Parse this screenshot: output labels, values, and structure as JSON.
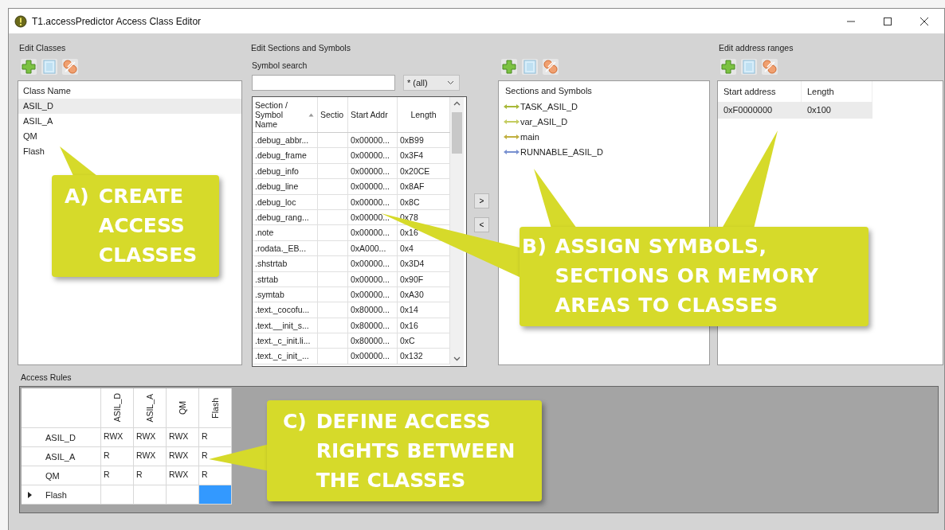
{
  "window": {
    "title": "T1.accessPredictor Access Class Editor"
  },
  "edit_classes": {
    "label": "Edit Classes",
    "column": "Class Name",
    "classes": [
      {
        "name": "ASIL_D",
        "selected": true
      },
      {
        "name": "ASIL_A",
        "selected": false
      },
      {
        "name": "QM",
        "selected": false
      },
      {
        "name": "Flash",
        "selected": false
      }
    ]
  },
  "edit_sections": {
    "label": "Edit Sections and Symbols",
    "search_label": "Symbol search",
    "filter": "* (all)",
    "columns": [
      "Section / Symbol Name",
      "Sectio",
      "Start Addr",
      "Length"
    ],
    "rows": [
      {
        "name": ".debug_abbr...",
        "start": "0x00000...",
        "length": "0xB99"
      },
      {
        "name": ".debug_frame",
        "start": "0x00000...",
        "length": "0x3F4"
      },
      {
        "name": ".debug_info",
        "start": "0x00000...",
        "length": "0x20CE"
      },
      {
        "name": ".debug_line",
        "start": "0x00000...",
        "length": "0x8AF"
      },
      {
        "name": ".debug_loc",
        "start": "0x00000...",
        "length": "0x8C"
      },
      {
        "name": ".debug_rang...",
        "start": "0x00000...",
        "length": "0x78"
      },
      {
        "name": ".note",
        "start": "0x00000...",
        "length": "0x16"
      },
      {
        "name": ".rodata._EB...",
        "start": "0xA000...",
        "length": "0x4"
      },
      {
        "name": ".shstrtab",
        "start": "0x00000...",
        "length": "0x3D4"
      },
      {
        "name": ".strtab",
        "start": "0x00000...",
        "length": "0x90F"
      },
      {
        "name": ".symtab",
        "start": "0x00000...",
        "length": "0xA30"
      },
      {
        "name": ".text._cocofu...",
        "start": "0x80000...",
        "length": "0x14"
      },
      {
        "name": ".text.__init_s...",
        "start": "0x80000...",
        "length": "0x16"
      },
      {
        "name": ".text._c_init.li...",
        "start": "0x80000...",
        "length": "0xC"
      },
      {
        "name": ".text._c_init_...",
        "start": "0x00000...",
        "length": "0x132"
      }
    ],
    "move_buttons": [
      ">",
      "<"
    ],
    "assigned_header": "Sections and Symbols",
    "assigned": [
      {
        "name": "TASK_ASIL_D",
        "color": "#a8b838"
      },
      {
        "name": "var_ASIL_D",
        "color": "#c4cc60"
      },
      {
        "name": "main",
        "color": "#c0b040"
      },
      {
        "name": "RUNNABLE_ASIL_D",
        "color": "#7890d0"
      }
    ]
  },
  "address_ranges": {
    "label": "Edit address ranges",
    "columns": [
      "Start address",
      "Length"
    ],
    "rows": [
      {
        "start": "0xF0000000",
        "length": "0x100",
        "selected": true
      }
    ]
  },
  "access_rules": {
    "label": "Access Rules",
    "columns": [
      "ASIL_D",
      "ASIL_A",
      "QM",
      "Flash"
    ],
    "rows": [
      {
        "name": "ASIL_D",
        "current": false,
        "cells": [
          {
            "text": "RWX",
            "selected": false
          },
          {
            "text": "RWX",
            "selected": false
          },
          {
            "text": "RWX",
            "selected": false
          },
          {
            "text": "R",
            "selected": false
          }
        ]
      },
      {
        "name": "ASIL_A",
        "current": false,
        "cells": [
          {
            "text": "R",
            "selected": false
          },
          {
            "text": "RWX",
            "selected": false
          },
          {
            "text": "RWX",
            "selected": false
          },
          {
            "text": "R",
            "selected": false
          }
        ]
      },
      {
        "name": "QM",
        "current": false,
        "cells": [
          {
            "text": "R",
            "selected": false
          },
          {
            "text": "R",
            "selected": false
          },
          {
            "text": "RWX",
            "selected": false
          },
          {
            "text": "R",
            "selected": false
          }
        ]
      },
      {
        "name": "Flash",
        "current": true,
        "cells": [
          {
            "selected": false
          },
          {
            "selected": false
          },
          {
            "selected": false
          },
          {
            "selected": true
          }
        ]
      }
    ]
  },
  "callouts": [
    {
      "label": "A)",
      "lines": [
        "CREATE",
        "ACCESS",
        "CLASSES"
      ]
    },
    {
      "label": "B)",
      "lines": [
        "ASSIGN SYMBOLS,",
        "SECTIONS OR MEMORY",
        "AREAS TO CLASSES"
      ]
    },
    {
      "label": "C)",
      "lines": [
        "DEFINE ACCESS",
        "RIGHTS BETWEEN",
        "THE CLASSES"
      ]
    }
  ]
}
